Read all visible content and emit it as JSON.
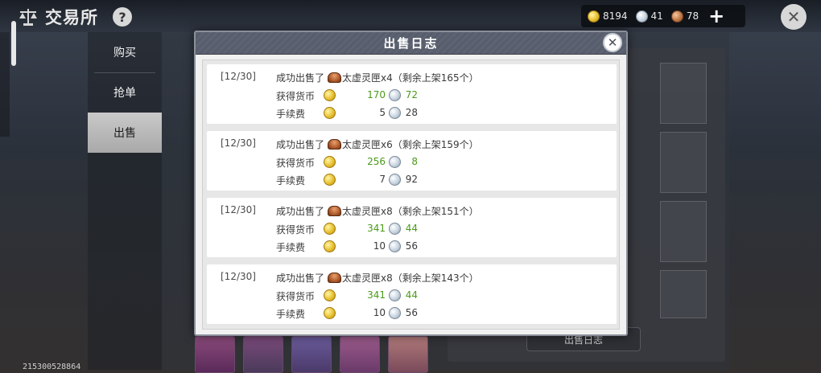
{
  "app": {
    "title": "交易所",
    "help_symbol": "?"
  },
  "currency": {
    "gold": "8194",
    "silver": "41",
    "copper": "78",
    "add_symbol": "+"
  },
  "sidebar": {
    "tabs": [
      {
        "label": "购买"
      },
      {
        "label": "抢单"
      },
      {
        "label": "出售",
        "selected": true
      }
    ]
  },
  "main": {
    "sale_log_button": "出售日志"
  },
  "user_id": "215300528864",
  "modal": {
    "title": "出售日志",
    "fee_label": "手续费",
    "gain_label": "获得货币",
    "entries": [
      {
        "date": "[12/30]",
        "sold_prefix": "成功出售了",
        "item": "太虚灵匣x4（剩余上架165个）",
        "gain_gold": "170",
        "gain_silver": "72",
        "fee_gold": "5",
        "fee_silver": "28"
      },
      {
        "date": "[12/30]",
        "sold_prefix": "成功出售了",
        "item": "太虚灵匣x6（剩余上架159个）",
        "gain_gold": "256",
        "gain_silver": "8",
        "fee_gold": "7",
        "fee_silver": "92"
      },
      {
        "date": "[12/30]",
        "sold_prefix": "成功出售了",
        "item": "太虚灵匣x8（剩余上架151个）",
        "gain_gold": "341",
        "gain_silver": "44",
        "fee_gold": "10",
        "fee_silver": "56"
      },
      {
        "date": "[12/30]",
        "sold_prefix": "成功出售了",
        "item": "太虚灵匣x8（剩余上架143个）",
        "gain_gold": "341",
        "gain_silver": "44",
        "fee_gold": "10",
        "fee_silver": "56"
      }
    ]
  },
  "colors": {
    "gain": "#4a9a1a",
    "header": "#5d6372"
  }
}
